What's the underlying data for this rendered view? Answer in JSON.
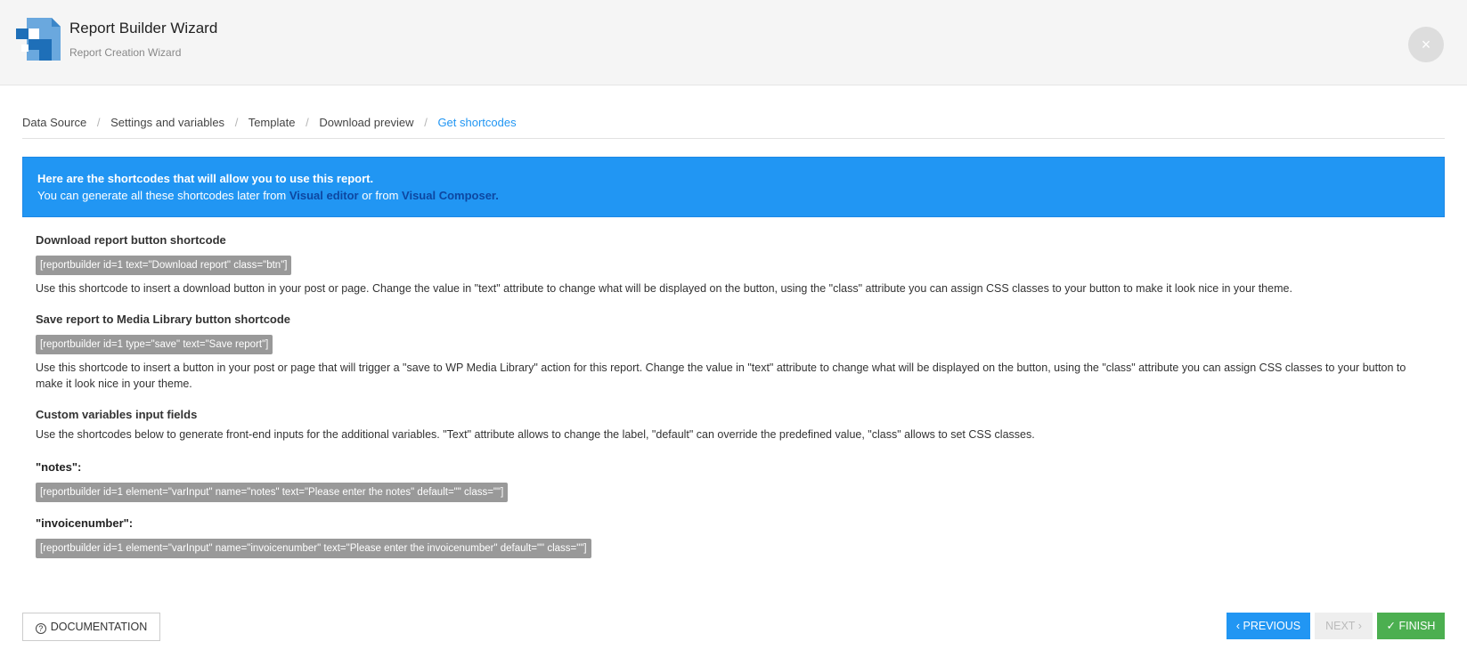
{
  "header": {
    "title": "Report Builder Wizard",
    "subtitle": "Report Creation Wizard",
    "close_label": "×",
    "colors": {
      "logo_dark": "#1e6fb8",
      "logo_light": "#6aa8de"
    }
  },
  "breadcrumb": {
    "items": [
      {
        "label": "Data Source"
      },
      {
        "label": "Settings and variables"
      },
      {
        "label": "Template"
      },
      {
        "label": "Download preview"
      },
      {
        "label": "Get shortcodes",
        "active": true
      }
    ],
    "separator": "/"
  },
  "info": {
    "title": "Here are the shortcodes that will allow you to use this report.",
    "line_prefix": "You can generate all these shortcodes later from ",
    "link1": "Visual editor",
    "line_middle": " or from ",
    "link2": "Visual Composer."
  },
  "sections": {
    "download": {
      "title": "Download report button shortcode",
      "code": "[reportbuilder id=1 text=\"Download report\" class=\"btn\"]",
      "desc": "Use this shortcode to insert a download button in your post or page. Change the value in \"text\" attribute to change what will be displayed on the button, using the \"class\" attribute you can assign CSS classes to your button to make it look nice in your theme."
    },
    "save": {
      "title": "Save report to Media Library button shortcode",
      "code": "[reportbuilder id=1 type=\"save\" text=\"Save report\"]",
      "desc": "Use this shortcode to insert a button in your post or page that will trigger a \"save to WP Media Library\" action for this report. Change the value in \"text\" attribute to change what will be displayed on the button, using the \"class\" attribute you can assign CSS classes to your button to make it look nice in your theme."
    },
    "custom": {
      "title": "Custom variables input fields",
      "desc": "Use the shortcodes below to generate front-end inputs for the additional variables. \"Text\" attribute allows to change the label, \"default\" can override the predefined value, \"class\" allows to set CSS classes.",
      "variables": [
        {
          "label": "\"notes\":",
          "code": "[reportbuilder id=1 element=\"varInput\" name=\"notes\" text=\"Please enter the notes\" default=\"\" class=\"\"]"
        },
        {
          "label": "\"invoicenumber\":",
          "code": "[reportbuilder id=1 element=\"varInput\" name=\"invoicenumber\" text=\"Please enter the invoicenumber\" default=\"\" class=\"\"]"
        }
      ]
    }
  },
  "footer": {
    "documentation_label": "DOCUMENTATION",
    "documentation_icon": "question-circle-icon",
    "previous_label": "PREVIOUS",
    "next_label": "NEXT",
    "finish_label": "FINISH",
    "colors": {
      "primary": "#2196f3",
      "success": "#4caf50",
      "disabled": "#eeeeee"
    }
  }
}
